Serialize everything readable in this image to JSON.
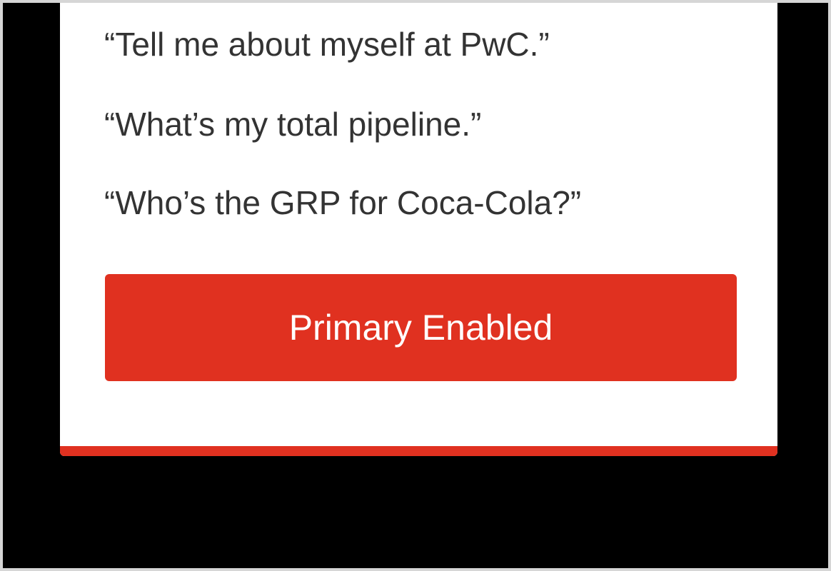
{
  "suggestions": [
    {
      "text": "“Tell me about myself at PwC.”"
    },
    {
      "text": "“What’s my total pipeline.”"
    },
    {
      "text": "“Who’s the GRP for Coca-Cola?”"
    }
  ],
  "primary_button": {
    "label": "Primary Enabled"
  },
  "colors": {
    "accent": "#e03120",
    "text": "#333333",
    "card_background": "#ffffff",
    "page_background": "#000000"
  }
}
